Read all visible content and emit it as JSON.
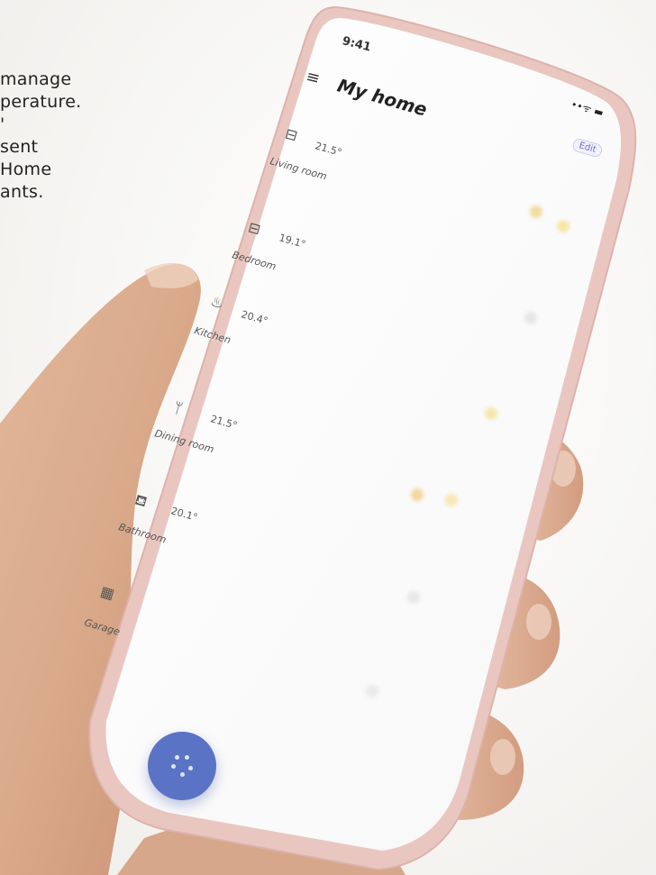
{
  "caption_lines": [
    "manage",
    "perature.",
    "'",
    "sent",
    "Home",
    "ants."
  ],
  "status": {
    "time": "9:41",
    "icons": "••ᯤ ▬"
  },
  "header": {
    "menu_icon": "hamburger-menu-icon",
    "title": "My home",
    "edit_label": "Edit"
  },
  "rooms": [
    {
      "icon": "sofa-icon",
      "glyph": "⊟",
      "temp": "21.5°",
      "name": "Living room"
    },
    {
      "icon": "bed-icon",
      "glyph": "⊟",
      "temp": "19.1°",
      "name": "Bedroom"
    },
    {
      "icon": "pot-icon",
      "glyph": "♨",
      "temp": "20.4°",
      "name": "Kitchen"
    },
    {
      "icon": "cutlery-icon",
      "glyph": "ᛘ",
      "temp": "21.5°",
      "name": "Dining room"
    },
    {
      "icon": "bathtub-icon",
      "glyph": "⛾",
      "temp": "20.1°",
      "name": "Bathroom"
    },
    {
      "icon": "garage-icon",
      "glyph": "▦",
      "temp": "",
      "name": "Garage"
    }
  ],
  "fab": {
    "icon": "dots-menu-icon"
  },
  "colors": {
    "accent": "#5a73c4",
    "frame": "#e8c8c2",
    "background": "#f6f5f3"
  }
}
